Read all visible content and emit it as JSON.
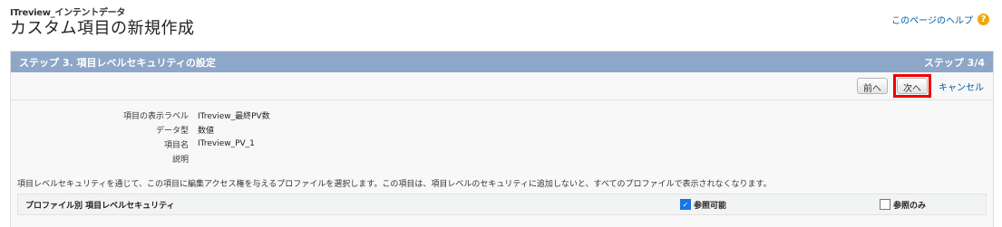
{
  "breadcrumb": "ITreview_インテントデータ",
  "page_title": "カスタム項目の新規作成",
  "help": {
    "link_text": "このページのヘルプ",
    "icon": "question-icon"
  },
  "step": {
    "title": "ステップ 3. 項目レベルセキュリティの設定",
    "counter": "ステップ 3/4"
  },
  "buttons": {
    "prev": "前へ",
    "next": "次へ",
    "cancel": "キャンセル"
  },
  "fields": [
    {
      "label": "項目の表示ラベル",
      "value": "ITreview_最終PV数"
    },
    {
      "label": "データ型",
      "value": "数値"
    },
    {
      "label": "項目名",
      "value": "ITreview_PV_1"
    },
    {
      "label": "説明",
      "value": ""
    }
  ],
  "note": "項目レベルセキュリティを通じて、この項目に編集アクセス権を与えるプロファイルを選択します。この項目は、項目レベルのセキュリティに追加しないと、すべてのプロファイルで表示されなくなります。",
  "table": {
    "header": "プロファイル別 項目レベルセキュリティ",
    "col_visible": "参照可能",
    "col_readonly": "参照のみ",
    "visible_checked": true,
    "readonly_checked": false
  },
  "colors": {
    "header_bar": "#8ea6c7",
    "link": "#015ba7",
    "highlight": "#e00000"
  }
}
